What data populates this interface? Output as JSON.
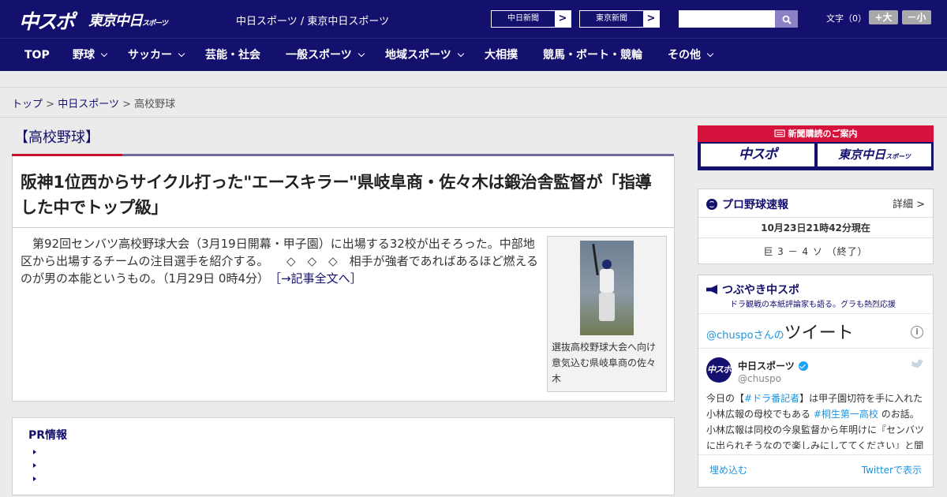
{
  "header": {
    "logo_main": "中スポ",
    "logo_tokyo": "東京中日",
    "logo_tokyo_suffix": "スポーツ",
    "site_name": "中日スポーツ / 東京中日スポーツ",
    "ext_links": [
      {
        "label": "中日新聞",
        "arrow": ">"
      },
      {
        "label": "東京新聞",
        "arrow": ">"
      }
    ],
    "search": {
      "value": "",
      "placeholder": ""
    },
    "font_size_label": "文字（0）",
    "font_plus": "+大",
    "font_minus": "－小",
    "colors": {
      "brand": "#14106e",
      "accent_red": "#d4123c",
      "search_button": "#8a82c5"
    }
  },
  "nav": {
    "items": [
      {
        "label": "TOP",
        "dropdown": false
      },
      {
        "label": "野球",
        "dropdown": true
      },
      {
        "label": "サッカー",
        "dropdown": true
      },
      {
        "label": "芸能・社会",
        "dropdown": false
      },
      {
        "label": "一般スポーツ",
        "dropdown": true
      },
      {
        "label": "地域スポーツ",
        "dropdown": true
      },
      {
        "label": "大相撲",
        "dropdown": false
      },
      {
        "label": "競馬・ボート・競輪",
        "dropdown": false
      },
      {
        "label": "その他",
        "dropdown": true
      }
    ]
  },
  "breadcrumb": {
    "items": [
      "トップ",
      "中日スポーツ",
      "高校野球"
    ],
    "separator": ">"
  },
  "category": {
    "title": "【高校野球】"
  },
  "article": {
    "title": "阪神1位西からサイクル打った\"エースキラー\"県岐阜商・佐々木は鍛治舎監督が「指導した中でトップ級」",
    "body": "　第92回センバツ高校野球大会（3月19日開幕・甲子園）に出場する32校が出そろった。中部地区から出場するチームの注目選手を紹介する。　　◇　◇　◇　相手が強者であればあるほど燃えるのが男の本能というもの。（1月29日 0時4分）",
    "read_more": "［→記事全文へ］",
    "photo_caption": "選抜高校野球大会へ向け意気込む県岐阜商の佐々木"
  },
  "pr": {
    "title": "PR情報",
    "items": [
      "",
      "",
      ""
    ]
  },
  "sidebar": {
    "subscribe": {
      "header": "新聞購読のご案内",
      "btn1": "中スポ",
      "btn2": "東京中日",
      "btn2_suffix": "スポーツ"
    },
    "baseball": {
      "title": "プロ野球速報",
      "detail": "詳細 >",
      "time": "10月23日21時42分現在",
      "score": "巨 3 － 4 ソ （終了）"
    },
    "twitter": {
      "title": "つぶやき中スポ",
      "subtitle": "ドラ観戦の本紙評論家も語る。グラも熱烈応援",
      "tweets_of_prefix": "@chuspo",
      "tweets_of_mid": "さんの",
      "tweets_of_big": "ツイート",
      "account_name": "中日スポーツ",
      "account_handle": "@chuspo",
      "avatar_text": "中スポ",
      "tweet_parts": {
        "p1": "今日の【",
        "h1": "#ドラ番記者",
        "p2": "】は甲子園切符を手に入れた小林広報の母校でもある ",
        "h2": "#桐生第一高校",
        "p3": " のお話。小林広報は同校の今泉監督から年明けに『センバツに出られそうなので楽しみにしててください』と聞い"
      },
      "embed": "埋め込む",
      "view_on": "Twitterで表示"
    }
  }
}
